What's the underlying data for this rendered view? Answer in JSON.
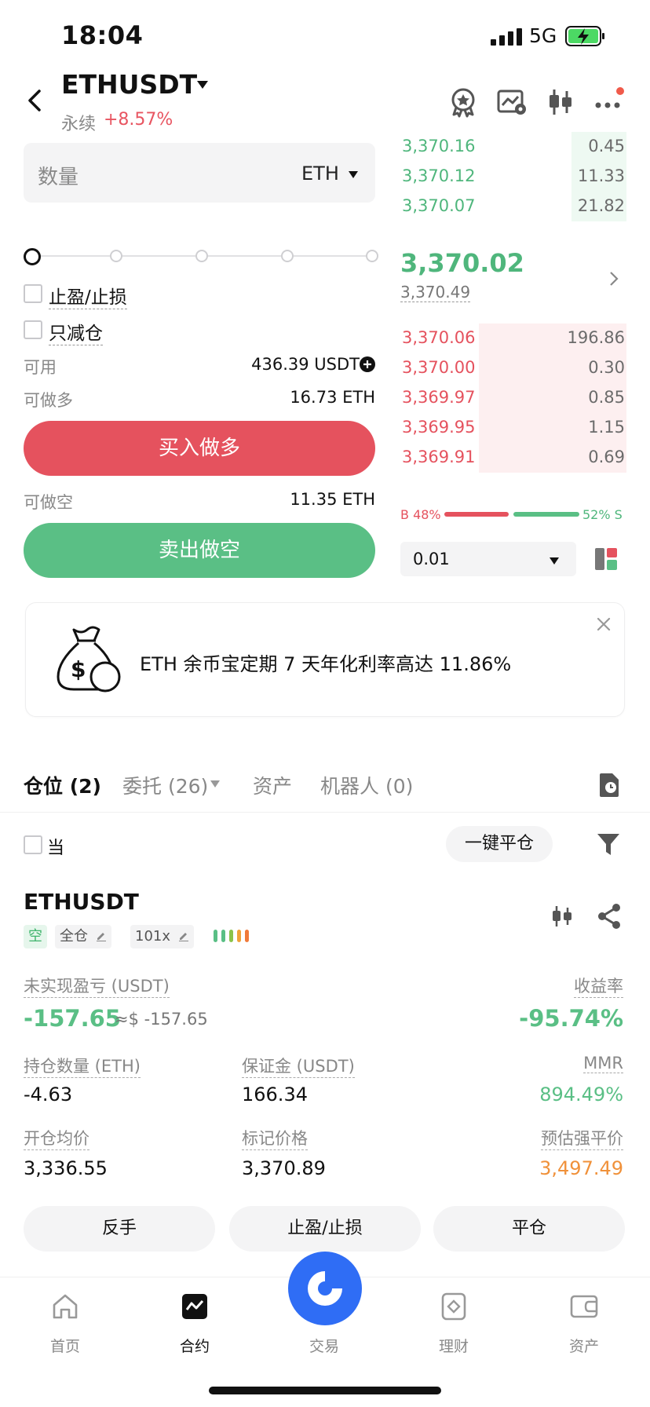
{
  "status_bar": {
    "time": "18:04",
    "network": "5G"
  },
  "header": {
    "pair": "ETHUSDT",
    "contract_type": "永续",
    "change": "+8.57%"
  },
  "order_form": {
    "quantity_placeholder": "数量",
    "quantity_unit": "ETH",
    "tp_sl_label": "止盈/止损",
    "reduce_only_label": "只减仓",
    "available_label": "可用",
    "available_value": "436.39 USDT",
    "can_long_label": "可做多",
    "can_long_value": "16.73 ETH",
    "buy_long_button": "买入做多",
    "can_short_label": "可做空",
    "can_short_value": "11.35 ETH",
    "sell_short_button": "卖出做空"
  },
  "order_book": {
    "asks_top": [
      {
        "price": "3,370.16",
        "qty": "0.45",
        "depth": 0.24
      },
      {
        "price": "3,370.12",
        "qty": "11.33",
        "depth": 0.24
      },
      {
        "price": "3,370.07",
        "qty": "21.82",
        "depth": 0.24
      }
    ],
    "last_price": "3,370.02",
    "mark_price": "3,370.49",
    "bids": [
      {
        "price": "3,370.06",
        "qty": "196.86",
        "depth": 0.65
      },
      {
        "price": "3,370.00",
        "qty": "0.30",
        "depth": 0.65
      },
      {
        "price": "3,369.97",
        "qty": "0.85",
        "depth": 0.65
      },
      {
        "price": "3,369.95",
        "qty": "1.15",
        "depth": 0.65
      },
      {
        "price": "3,369.91",
        "qty": "0.69",
        "depth": 0.65
      }
    ],
    "buy_ratio": "B 48%",
    "sell_ratio": "52% S",
    "precision": "0.01"
  },
  "banner": {
    "text": "ETH 余币宝定期 7 天年化利率高达 11.86%"
  },
  "tabs": {
    "positions": "仓位 (2)",
    "orders": "委托 (26)",
    "assets": "资产",
    "bots": "机器人 (0)"
  },
  "filter": {
    "current_label": "当",
    "close_all_button": "一键平仓"
  },
  "position": {
    "symbol": "ETHUSDT",
    "side_tag": "空",
    "margin_mode": "全仓",
    "leverage": "101x",
    "upnl_label": "未实现盈亏 (USDT)",
    "upnl_value": "-157.65",
    "upnl_usd": "≈$ -157.65",
    "roe_label": "收益率",
    "roe_value": "-95.74%",
    "size_label": "持仓数量 (ETH)",
    "size_value": "-4.63",
    "margin_label": "保证金 (USDT)",
    "margin_value": "166.34",
    "mmr_label": "MMR",
    "mmr_value": "894.49%",
    "entry_label": "开仓均价",
    "entry_value": "3,336.55",
    "mark_label": "标记价格",
    "mark_value": "3,370.89",
    "liq_label": "预估强平价",
    "liq_value": "3,497.49",
    "reverse_button": "反手",
    "tpsl_button": "止盈/止损",
    "close_button": "平仓"
  },
  "bottom_nav": {
    "home": "首页",
    "futures": "合约",
    "trade": "交易",
    "earn": "理财",
    "assets": "资产"
  },
  "colors": {
    "buy": "#5abf85",
    "sell": "#e5525e",
    "brand": "#2f6df5",
    "liquidation": "#f0913a"
  }
}
